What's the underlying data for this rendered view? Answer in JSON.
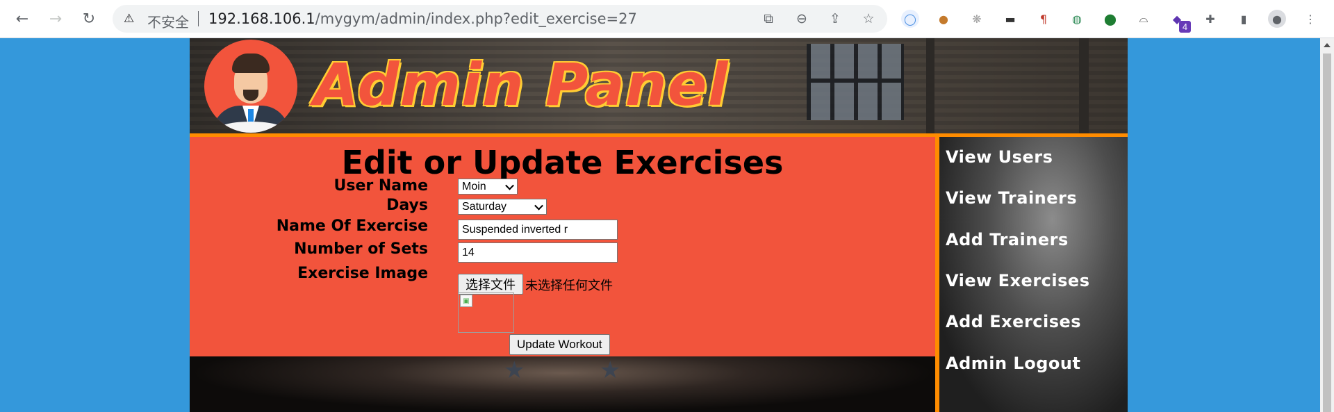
{
  "browser": {
    "back_icon": "arrow-left-icon",
    "forward_icon": "arrow-right-icon",
    "reload_icon": "reload-icon",
    "security_label": "不安全",
    "url_host": "192.168.106.1",
    "url_rest": "/mygym/admin/index.php?edit_exercise=27",
    "extension_badge": "4"
  },
  "header": {
    "title": "Admin Panel"
  },
  "form": {
    "title": "Edit or Update Exercises",
    "user_name_label": "User Name",
    "user_name_value": "Moin",
    "days_label": "Days",
    "days_value": "Saturday",
    "exercise_name_label": "Name Of Exercise",
    "exercise_name_value": "Suspended inverted r",
    "sets_label": "Number of Sets",
    "sets_value": "14",
    "image_label": "Exercise Image",
    "file_button": "选择文件",
    "file_status": "未选择任何文件",
    "submit_label": "Update Workout"
  },
  "sidebar": {
    "items": [
      {
        "label": "View Users"
      },
      {
        "label": "View Trainers"
      },
      {
        "label": "Add Trainers"
      },
      {
        "label": "View Exercises"
      },
      {
        "label": "Add Exercises"
      },
      {
        "label": "Admin Logout"
      }
    ]
  },
  "colors": {
    "page_bg": "#3498db",
    "content_bg": "#f2543c",
    "accent_border": "#ff8c00"
  }
}
